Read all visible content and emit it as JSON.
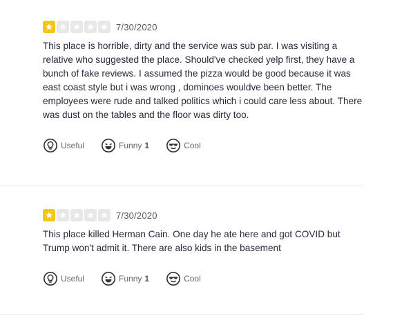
{
  "reviews": [
    {
      "rating": 1,
      "max_rating": 5,
      "date": "7/30/2020",
      "text": "This place is horrible, dirty and the service was sub par. I was visiting a relative who suggested the place.  Should've checked yelp first, they have a bunch of fake reviews. I assumed the pizza would be good because it was east coast style but i was wrong , dominoes wouldve been better. The employees were rude and talked politics which i could care less about. There was dust on the tables and the floor was dirty too.",
      "reactions": {
        "useful_label": "Useful",
        "funny_label": "Funny",
        "funny_count": "1",
        "cool_label": "Cool"
      }
    },
    {
      "rating": 1,
      "max_rating": 5,
      "date": "7/30/2020",
      "text": "This place killed Herman Cain. One day he ate here and got COVID but Trump won't admit it. There are also kids in the basement",
      "reactions": {
        "useful_label": "Useful",
        "funny_label": "Funny",
        "funny_count": "1",
        "cool_label": "Cool"
      }
    }
  ],
  "colors": {
    "star_filled": "#f5c518",
    "star_empty": "#e8e8e8",
    "text": "#2b273c",
    "muted": "#666666"
  },
  "icons": {
    "star": "star-icon",
    "useful": "lightbulb-icon",
    "funny": "laughing-face-icon",
    "cool": "sunglasses-face-icon"
  }
}
